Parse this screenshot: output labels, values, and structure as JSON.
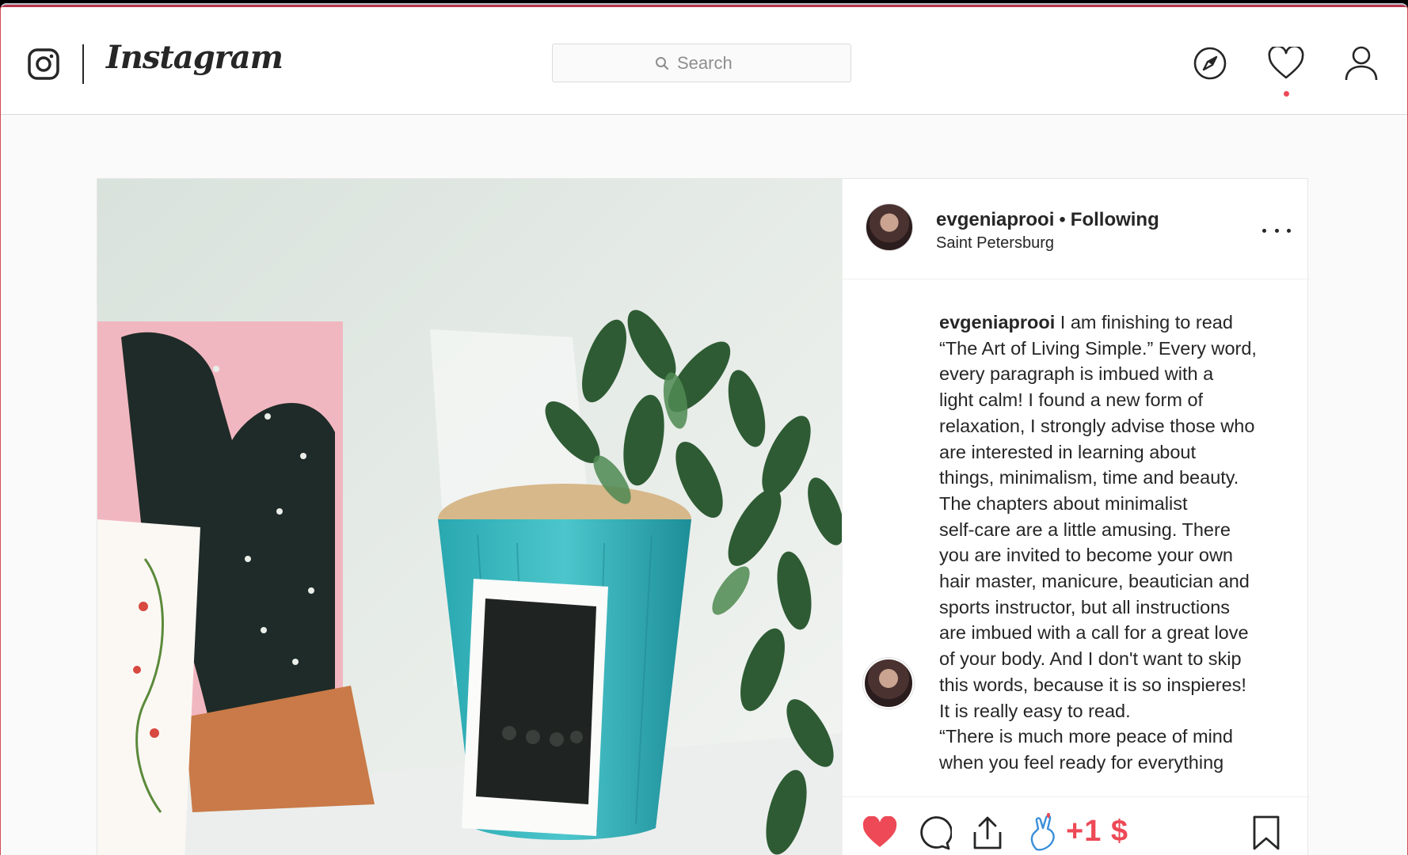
{
  "app": {
    "logo_text": "Instagram",
    "accent_color": "#ed4956"
  },
  "search": {
    "placeholder": "Search",
    "icon": "search-icon"
  },
  "nav": {
    "icons": [
      "compass-icon",
      "heart-icon",
      "profile-icon"
    ],
    "notification_dot": true
  },
  "post": {
    "author": {
      "username": "evgeniaprooi",
      "separator": "•",
      "follow_status": "Following",
      "location": "Saint Petersburg"
    },
    "caption": {
      "username": "evgeniaprooi",
      "text": " I am finishing to read\n“The Art of Living Simple.” Every word,\nevery paragraph is imbued with a\nlight calm! I found a new form of\nrelaxation, I strongly advise those who\nare interested in learning about\nthings, minimalism, time and beauty.\nThe chapters about minimalist\nself-care are a little amusing. There\nyou are invited to become your own\nhair master, manicure, beautician and\nsports instructor, but all instructions\nare imbued with a call for a great love\nof your body. And I don't want to skip\nthis words, because it is so inspieres!\nIt is really easy to read.\n“There is much more peace of mind\nwhen you feel ready for everything"
    },
    "actions": {
      "liked": true,
      "tip_label": "+1 $",
      "icons": [
        "heart-filled-icon",
        "comment-icon",
        "share-icon",
        "tip-hand-icon",
        "bookmark-icon"
      ]
    }
  }
}
